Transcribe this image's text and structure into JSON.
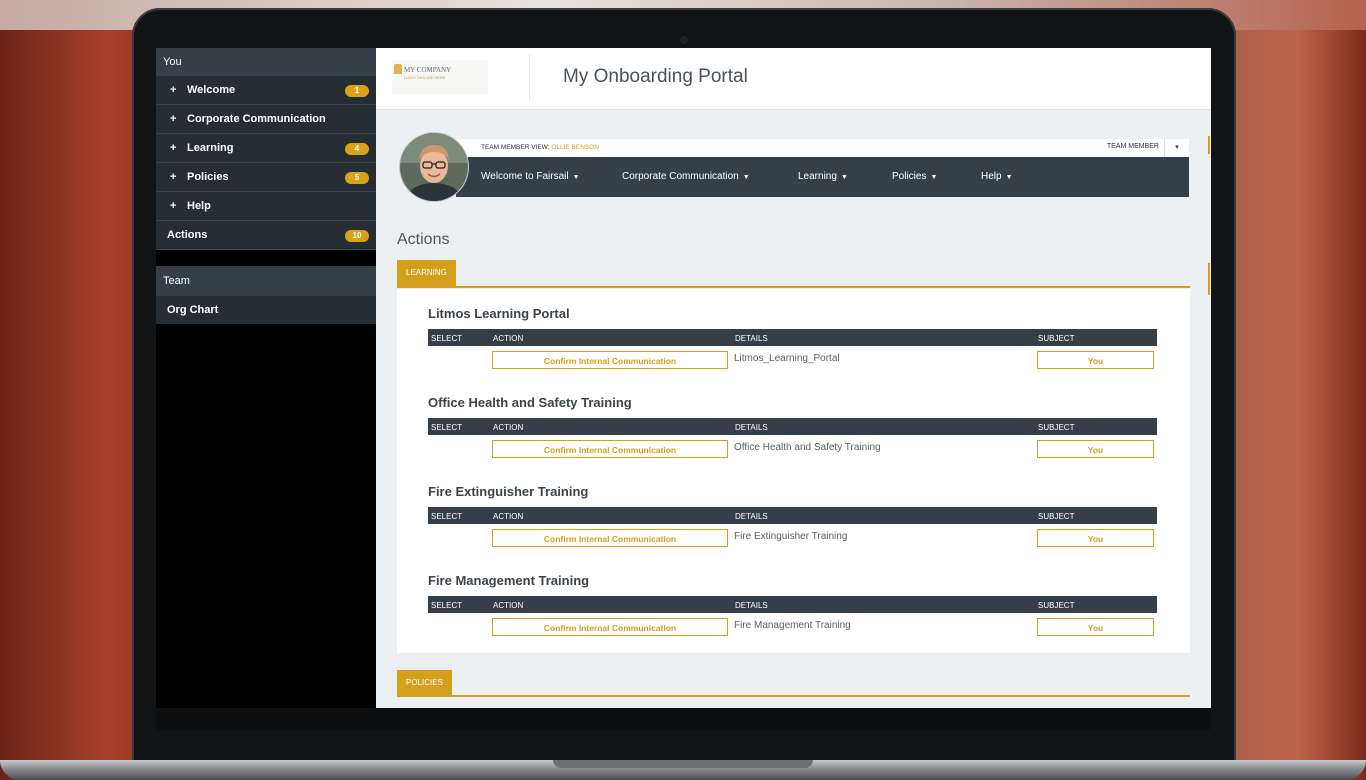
{
  "sidebar": {
    "you_header": "You",
    "items": [
      {
        "plus": "+",
        "label": "Welcome",
        "badge": "1"
      },
      {
        "plus": "+",
        "label": "Corporate Communication",
        "badge": ""
      },
      {
        "plus": "+",
        "label": "Learning",
        "badge": "4"
      },
      {
        "plus": "+",
        "label": "Policies",
        "badge": "5"
      },
      {
        "plus": "+",
        "label": "Help",
        "badge": ""
      }
    ],
    "actions": {
      "label": "Actions",
      "badge": "10"
    },
    "team_header": "Team",
    "org_chart": "Org Chart"
  },
  "header": {
    "logo_name": "MY COMPANY",
    "logo_tagline": "LOGO TAGLINE HERE",
    "title": "My Onboarding Portal"
  },
  "profile": {
    "view_label": "TEAM MEMBER VIEW: ",
    "view_name": "OLLIE BENSON",
    "role": "TEAM MEMBER",
    "caret": "▾"
  },
  "nav": [
    {
      "label": "Welcome to Fairsail"
    },
    {
      "label": "Corporate Communication"
    },
    {
      "label": "Learning"
    },
    {
      "label": "Policies"
    },
    {
      "label": "Help"
    }
  ],
  "main": {
    "section_title": "Actions",
    "tab_learning": "LEARNING",
    "tab_policies": "POLICIES",
    "columns": {
      "select": "SELECT",
      "action": "ACTION",
      "details": "DETAILS",
      "subject": "SUBJECT"
    },
    "groups": [
      {
        "title": "Litmos Learning Portal",
        "action": "Confirm Internal Communication",
        "details": "Litmos_Learning_Portal",
        "subject": "You"
      },
      {
        "title": "Office Health and Safety Training",
        "action": "Confirm Internal Communication",
        "details": "Office Health and Safety Training",
        "subject": "You"
      },
      {
        "title": "Fire Extinguisher Training",
        "action": "Confirm Internal Communication",
        "details": "Fire Extinguisher Training",
        "subject": "You"
      },
      {
        "title": "Fire Management Training",
        "action": "Confirm Internal Communication",
        "details": "Fire Management Training",
        "subject": "You"
      }
    ]
  },
  "colors": {
    "accent": "#d49f1b",
    "dark_bar": "#363f47",
    "sidebar_item": "#262d33"
  }
}
